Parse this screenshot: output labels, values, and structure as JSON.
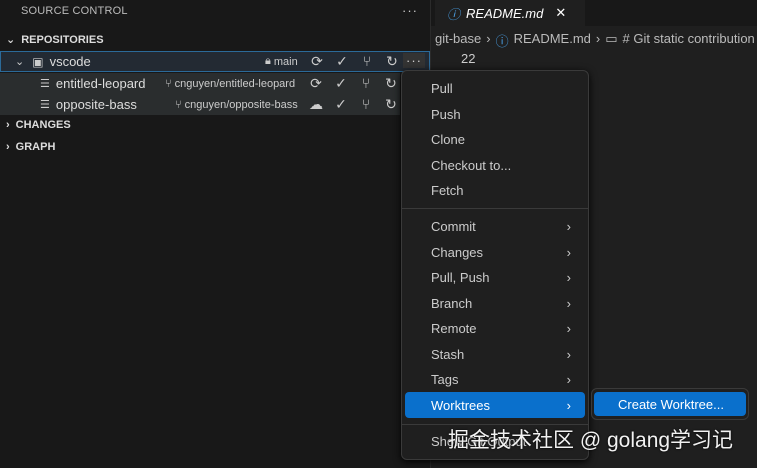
{
  "sidebar": {
    "title": "SOURCE CONTROL",
    "more": "···",
    "sections": {
      "repositories": "REPOSITORIES",
      "changes": "CHANGES",
      "graph": "GRAPH"
    },
    "repo": {
      "name": "vscode",
      "branch": "main"
    },
    "worktrees": [
      {
        "name": "entitled-leopard",
        "branch": "cnguyen/entitled-leopard"
      },
      {
        "name": "opposite-bass",
        "branch": "cnguyen/opposite-bass"
      }
    ]
  },
  "editor": {
    "tab": "README.md",
    "crumbs": [
      "git-base",
      "README.md",
      "# Git static contribution"
    ],
    "line": "22"
  },
  "menu": {
    "items": [
      "Pull",
      "Push",
      "Clone",
      "Checkout to...",
      "Fetch"
    ],
    "submenus": [
      "Commit",
      "Changes",
      "Pull, Push",
      "Branch",
      "Remote",
      "Stash",
      "Tags",
      "Worktrees"
    ],
    "last": "Show Git Output",
    "submenu_item": "Create Worktree..."
  },
  "watermark": "掘金技术社区 @ golang学习记",
  "colors": {
    "accent": "#0a70cc"
  }
}
